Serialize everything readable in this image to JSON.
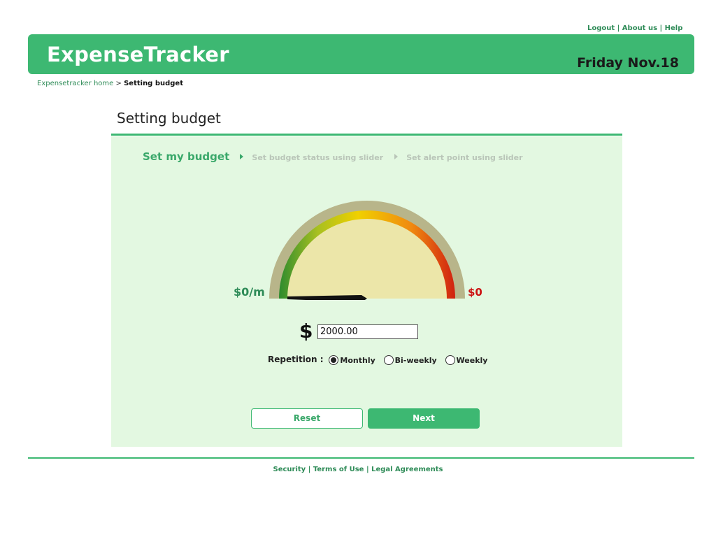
{
  "top_links": {
    "logout": "Logout",
    "about": "About us",
    "help": "Help",
    "separator": "|"
  },
  "header": {
    "logo": "ExpenseTracker",
    "date": "Friday Nov.18"
  },
  "breadcrumb": {
    "home": "Expensetracker home",
    "separator": ">",
    "current": "Setting budget"
  },
  "page_title": "Setting budget",
  "steps": [
    {
      "label": "Set my budget",
      "active": true
    },
    {
      "label": "Set budget status using slider",
      "active": false
    },
    {
      "label": "Set alert point using slider",
      "active": false
    }
  ],
  "gauge": {
    "min_label": "$0/m",
    "max_label": "$0",
    "colors": {
      "outer": "#b8b58a",
      "inner": "#ece6a9",
      "arc_stops": [
        "#2e8b2e",
        "#a8c020",
        "#f0d000",
        "#f08a10",
        "#d02010"
      ],
      "needle": "#111111"
    }
  },
  "budget_input": {
    "currency_symbol": "$",
    "value": "2000.00"
  },
  "repetition": {
    "label": "Repetition :",
    "options": [
      "Monthly",
      "Bi-weekly",
      "Weekly"
    ],
    "selected": "Monthly"
  },
  "buttons": {
    "reset": "Reset",
    "next": "Next"
  },
  "footer": {
    "security": "Security",
    "terms": "Terms of Use",
    "legal": "Legal Agreements",
    "separator": "|"
  },
  "colors": {
    "brand_green": "#3db872",
    "panel_bg": "#e3f8e1",
    "link_green": "#2e8b57",
    "alert_red": "#cc1111"
  }
}
